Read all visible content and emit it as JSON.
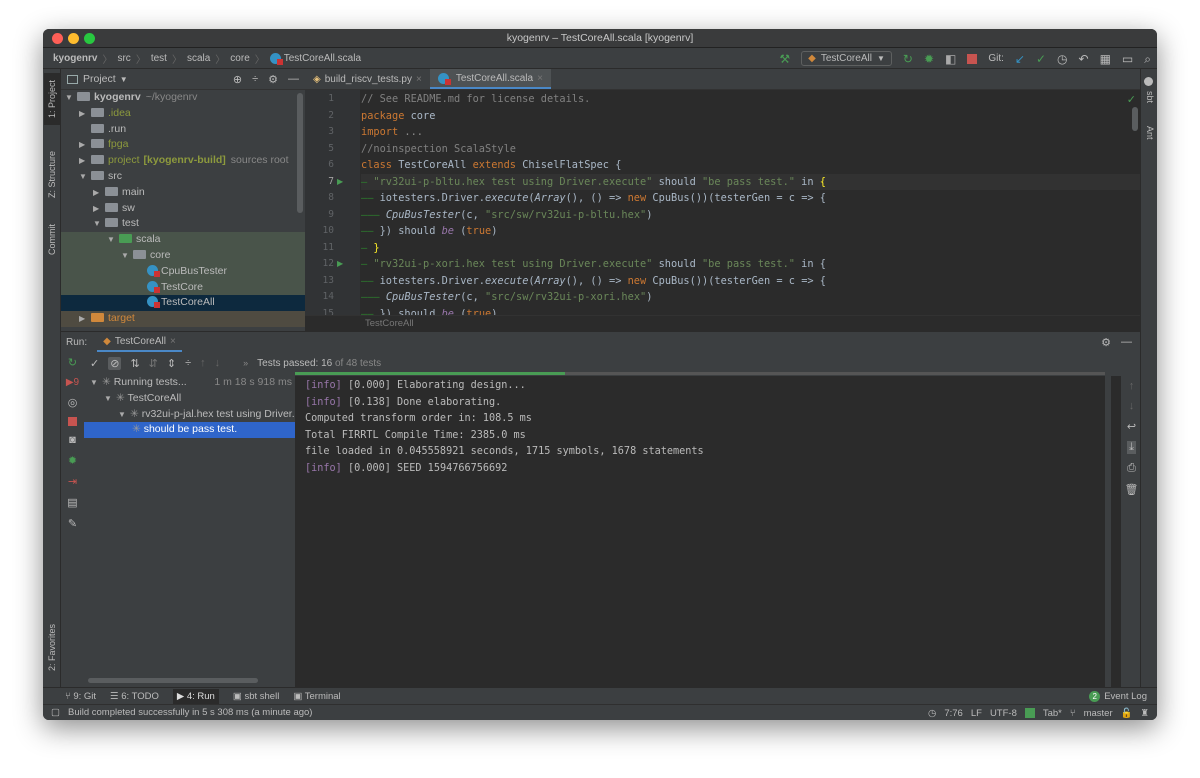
{
  "window": {
    "title": "kyogenrv – TestCoreAll.scala [kyogenrv]"
  },
  "breadcrumb": [
    "kyogenrv",
    "src",
    "test",
    "scala",
    "core",
    "TestCoreAll.scala"
  ],
  "toolbar": {
    "run_config": "TestCoreAll",
    "git_label": "Git:"
  },
  "left_stripe": {
    "project": "1: Project",
    "structure": "Z: Structure",
    "commit": "Commit",
    "favorites": "2: Favorites"
  },
  "right_stripe": {
    "sbt": "sbt",
    "ant": "Ant"
  },
  "project_panel": {
    "title": "Project",
    "tree": [
      {
        "label": "kyogenrv",
        "extra": "~/kyogenrv",
        "depth": 0,
        "arrow": "down",
        "kind": "module"
      },
      {
        "label": ".idea",
        "depth": 1,
        "arrow": "right",
        "kind": "folder",
        "color": "#8d9a3d"
      },
      {
        "label": ".run",
        "depth": 1,
        "arrow": "",
        "kind": "folder"
      },
      {
        "label": "fpga",
        "depth": 1,
        "arrow": "right",
        "kind": "folder",
        "color": "#8d9a3d"
      },
      {
        "label": "project",
        "bold": "[kyogenrv-build]",
        "extra": "sources root",
        "depth": 1,
        "arrow": "right",
        "kind": "folder",
        "color": "#8d9a3d"
      },
      {
        "label": "src",
        "depth": 1,
        "arrow": "down",
        "kind": "folder"
      },
      {
        "label": "main",
        "depth": 2,
        "arrow": "right",
        "kind": "folder"
      },
      {
        "label": "sw",
        "depth": 2,
        "arrow": "right",
        "kind": "folder"
      },
      {
        "label": "test",
        "depth": 2,
        "arrow": "down",
        "kind": "folder"
      },
      {
        "label": "scala",
        "depth": 3,
        "arrow": "down",
        "kind": "testfolder",
        "hl": "test"
      },
      {
        "label": "core",
        "depth": 4,
        "arrow": "down",
        "kind": "package",
        "hl": "test"
      },
      {
        "label": "CpuBusTester",
        "depth": 5,
        "arrow": "",
        "kind": "scala",
        "hl": "test"
      },
      {
        "label": "TestCore",
        "depth": 5,
        "arrow": "",
        "kind": "scala",
        "hl": "test"
      },
      {
        "label": "TestCoreAll",
        "depth": 5,
        "arrow": "",
        "kind": "scala",
        "hl": "selected"
      },
      {
        "label": "target",
        "depth": 1,
        "arrow": "right",
        "kind": "excluded",
        "color": "#d0883b",
        "hl": "excluded"
      }
    ]
  },
  "editor": {
    "tabs": [
      {
        "label": "build_riscv_tests.py",
        "active": false
      },
      {
        "label": "TestCoreAll.scala",
        "active": true
      }
    ],
    "breadcrumb": "TestCoreAll",
    "lines": [
      {
        "n": "1",
        "t": [
          [
            "// See README.md for license details.",
            "c"
          ]
        ]
      },
      {
        "n": "2",
        "t": [
          [
            "package",
            "k"
          ],
          [
            " core",
            ""
          ]
        ]
      },
      {
        "n": "3",
        "t": [
          [
            "import",
            "k"
          ],
          [
            " ",
            ""
          ],
          [
            "...",
            "g"
          ]
        ]
      },
      {
        "n": "5",
        "t": [
          [
            "//noinspection ScalaStyle",
            "c"
          ]
        ]
      },
      {
        "n": "6",
        "t": [
          [
            "class",
            "k"
          ],
          [
            " TestCoreAll ",
            ""
          ],
          [
            "extends",
            "k"
          ],
          [
            " ChiselFlatSpec {",
            ""
          ]
        ]
      },
      {
        "n": "7",
        "cur": true,
        "run": true,
        "t": [
          [
            "— ",
            "d"
          ],
          [
            "\"rv32ui-p-bltu.hex test using Driver.execute\"",
            "s"
          ],
          [
            " should ",
            ""
          ],
          [
            "\"be pass test.\"",
            "s"
          ],
          [
            " in ",
            ""
          ],
          [
            "{",
            "y"
          ]
        ]
      },
      {
        "n": "8",
        "t": [
          [
            "—— ",
            "d"
          ],
          [
            "iotesters.Driver.",
            ""
          ],
          [
            "execute",
            "i"
          ],
          [
            "(",
            ""
          ],
          [
            "Array",
            "i"
          ],
          [
            "(), () => ",
            ""
          ],
          [
            "new",
            "k"
          ],
          [
            " CpuBus())(testerGen = c => {",
            ""
          ]
        ]
      },
      {
        "n": "9",
        "t": [
          [
            "——— ",
            "d"
          ],
          [
            "CpuBusTester",
            "i"
          ],
          [
            "(c, ",
            ""
          ],
          [
            "\"src/sw/rv32ui-p-bltu.hex\"",
            "s"
          ],
          [
            ")",
            ""
          ]
        ]
      },
      {
        "n": "10",
        "t": [
          [
            "—— ",
            "d"
          ],
          [
            "}) should ",
            ""
          ],
          [
            "be",
            "p"
          ],
          [
            " (",
            ""
          ],
          [
            "true",
            "k"
          ],
          [
            ")",
            ""
          ]
        ]
      },
      {
        "n": "11",
        "t": [
          [
            "— ",
            "d"
          ],
          [
            "}",
            "y"
          ]
        ]
      },
      {
        "n": "12",
        "run": true,
        "t": [
          [
            "— ",
            "d"
          ],
          [
            "\"rv32ui-p-xori.hex test using Driver.execute\"",
            "s"
          ],
          [
            " should ",
            ""
          ],
          [
            "\"be pass test.\"",
            "s"
          ],
          [
            " in {",
            ""
          ]
        ]
      },
      {
        "n": "13",
        "t": [
          [
            "—— ",
            "d"
          ],
          [
            "iotesters.Driver.",
            ""
          ],
          [
            "execute",
            "i"
          ],
          [
            "(",
            ""
          ],
          [
            "Array",
            "i"
          ],
          [
            "(), () => ",
            ""
          ],
          [
            "new",
            "k"
          ],
          [
            " CpuBus())(testerGen = c => {",
            ""
          ]
        ]
      },
      {
        "n": "14",
        "t": [
          [
            "——— ",
            "d"
          ],
          [
            "CpuBusTester",
            "i"
          ],
          [
            "(c, ",
            ""
          ],
          [
            "\"src/sw/rv32ui-p-xori.hex\"",
            "s"
          ],
          [
            ")",
            ""
          ]
        ]
      },
      {
        "n": "15",
        "t": [
          [
            "—— ",
            "d"
          ],
          [
            "}) should ",
            ""
          ],
          [
            "be",
            "p"
          ],
          [
            " (",
            ""
          ],
          [
            "true",
            "k"
          ],
          [
            ")",
            ""
          ]
        ]
      }
    ]
  },
  "run_panel": {
    "label": "Run:",
    "tab": "TestCoreAll",
    "status_prefix": "Tests passed: ",
    "passed": "16",
    "status_suffix": " of 48 tests",
    "progress": 0.333,
    "tree": [
      {
        "label": "Running tests...",
        "time": "1 m 18 s 918 ms",
        "depth": 0
      },
      {
        "label": "TestCoreAll",
        "depth": 1
      },
      {
        "label": "rv32ui-p-jal.hex test using Driver.execute",
        "depth": 2
      },
      {
        "label": "should be pass test.",
        "depth": 3,
        "selected": true
      }
    ],
    "console": [
      [
        [
          "[info]",
          "info"
        ],
        [
          " [0.000] Elaborating design...",
          ""
        ]
      ],
      [
        [
          "[info]",
          "info"
        ],
        [
          " [0.138] Done elaborating.",
          ""
        ]
      ],
      [
        [
          "Computed transform order in: 108.5 ms",
          ""
        ]
      ],
      [
        [
          "Total FIRRTL Compile Time: 2385.0 ms",
          ""
        ]
      ],
      [
        [
          "file loaded in 0.045558921 seconds, 1715 symbols, 1678 statements",
          ""
        ]
      ],
      [
        [
          "[info]",
          "info"
        ],
        [
          " [0.000] SEED 1594766756692",
          ""
        ]
      ]
    ]
  },
  "bottom_tabs": [
    "9: Git",
    "6: TODO",
    "4: Run",
    "sbt shell",
    "Terminal"
  ],
  "event_log": {
    "count": "2",
    "label": "Event Log"
  },
  "status_bar": {
    "message": "Build completed successfully in 5 s 308 ms (a minute ago)",
    "position": "7:76",
    "line_sep": "LF",
    "encoding": "UTF-8",
    "indent": "Tab*",
    "branch": "master"
  },
  "colors": {
    "accent": "#4a88c7",
    "selection": "#2f65ca",
    "green": "#499c54",
    "red": "#c75450"
  }
}
